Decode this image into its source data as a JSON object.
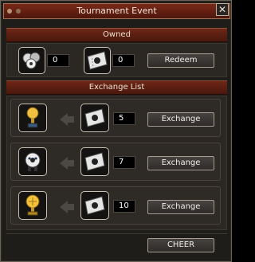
{
  "window": {
    "title": "Tournament Event",
    "close_label": "✕"
  },
  "owned": {
    "header": "Owned",
    "ball_count": "0",
    "ticket_count": "0",
    "redeem_label": "Redeem"
  },
  "exchange": {
    "header": "Exchange List",
    "items": [
      {
        "reward_icon": "gold-trophy-icon",
        "ticket_cost": "5",
        "button_label": "Exchange"
      },
      {
        "reward_icon": "soccer-ball-pet-icon",
        "ticket_cost": "7",
        "button_label": "Exchange"
      },
      {
        "reward_icon": "gold-football-trophy-icon",
        "ticket_cost": "10",
        "button_label": "Exchange"
      }
    ]
  },
  "footer": {
    "cheer_label": "CHEER"
  }
}
